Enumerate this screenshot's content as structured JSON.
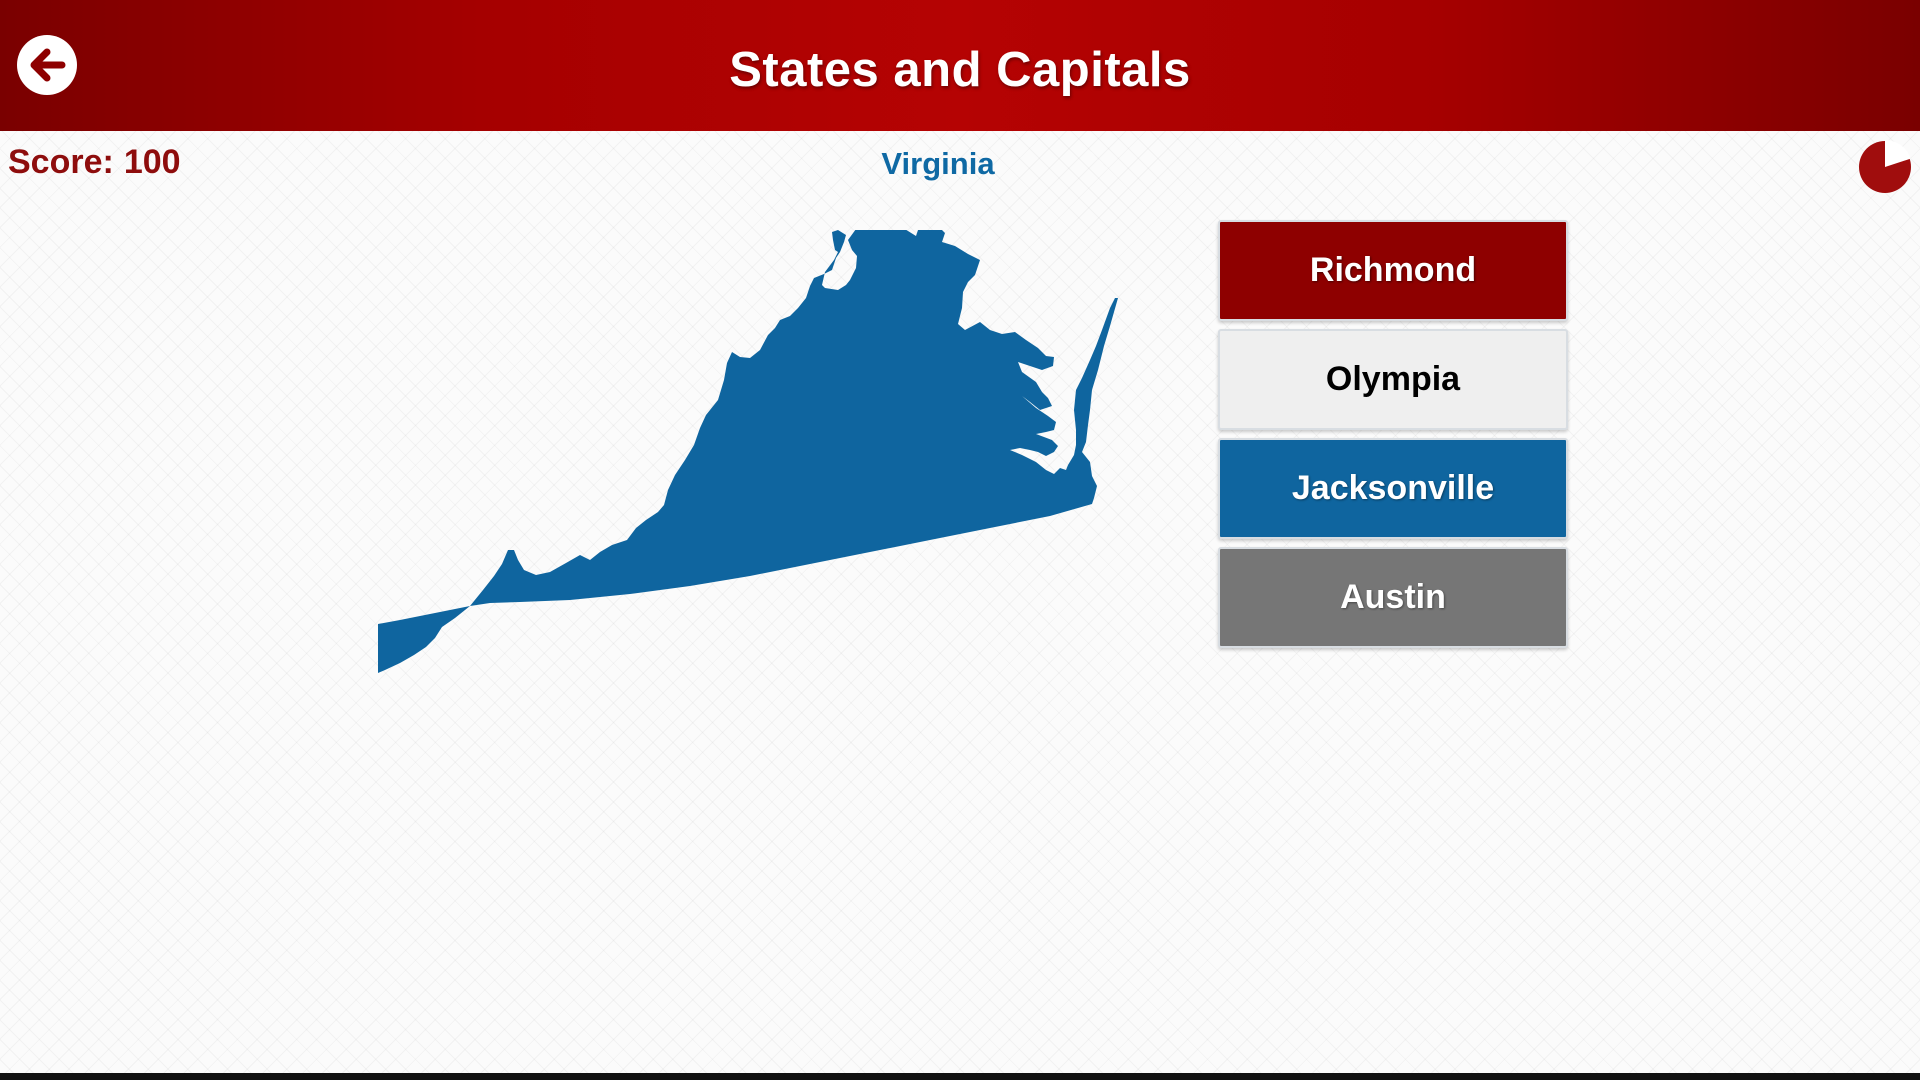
{
  "header": {
    "title": "States and Capitals",
    "back_icon": "back-arrow-icon"
  },
  "status": {
    "score_label": "Score:",
    "score_value": "100",
    "state_name": "Virginia",
    "timer_icon": "timer-pie-icon",
    "timer_elapsed_fraction": 0.2
  },
  "question": {
    "map_shape": "virginia-state-silhouette"
  },
  "answers": [
    {
      "label": "Richmond"
    },
    {
      "label": "Olympia"
    },
    {
      "label": "Jacksonville"
    },
    {
      "label": "Austin"
    }
  ],
  "colors": {
    "brand_red": "#8e0000",
    "state_blue": "#0f659f",
    "score_red": "#8e0d0d",
    "button_gray": "#767676",
    "button_light": "#efefef"
  }
}
